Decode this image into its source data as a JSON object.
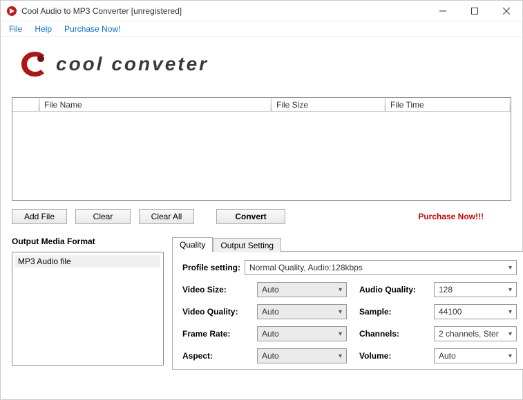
{
  "window": {
    "title": "Cool Audio to MP3 Converter  [unregistered]"
  },
  "menu": {
    "file": "File",
    "help": "Help",
    "purchase": "Purchase Now!"
  },
  "logo": {
    "text": "cool conveter"
  },
  "table": {
    "headers": {
      "name": "File Name",
      "size": "File Size",
      "time": "File Time"
    }
  },
  "buttons": {
    "add": "Add File",
    "clear": "Clear",
    "clearAll": "Clear All",
    "convert": "Convert"
  },
  "purchase_link": "Purchase Now!!!",
  "omf": {
    "title": "Output Media Format",
    "item": "MP3 Audio file"
  },
  "tabs": {
    "quality": "Quality",
    "output": "Output Setting"
  },
  "settings": {
    "profile_label": "Profile setting:",
    "profile_value": "Normal Quality, Audio:128kbps",
    "video_size_label": "Video Size:",
    "video_size_value": "Auto",
    "video_quality_label": "Video Quality:",
    "video_quality_value": "Auto",
    "frame_rate_label": "Frame Rate:",
    "frame_rate_value": "Auto",
    "aspect_label": "Aspect:",
    "aspect_value": "Auto",
    "audio_quality_label": "Audio Quality:",
    "audio_quality_value": "128",
    "sample_label": "Sample:",
    "sample_value": "44100",
    "channels_label": "Channels:",
    "channels_value": "2 channels, Ster",
    "volume_label": "Volume:",
    "volume_value": "Auto"
  }
}
